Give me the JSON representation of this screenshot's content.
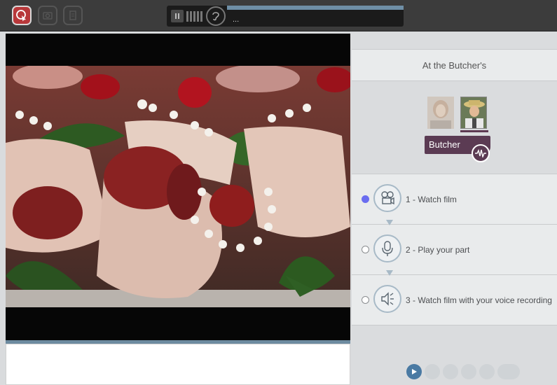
{
  "toolbar": {
    "buttons": [
      {
        "icon": "pointer-icon",
        "state": "active"
      },
      {
        "icon": "camera-icon",
        "state": "disabled"
      },
      {
        "icon": "document-icon",
        "state": "disabled"
      }
    ]
  },
  "player": {
    "status_text": "...",
    "progress": 1.0
  },
  "scene": {
    "title": "At the Butcher's"
  },
  "characters": [
    {
      "icon": "woman-avatar-icon",
      "selected": false
    },
    {
      "icon": "butcher-avatar-icon",
      "selected": true
    }
  ],
  "role": {
    "label": "Butcher"
  },
  "steps": [
    {
      "label": "1 - Watch film",
      "selected": true,
      "icon": "film-camera-icon"
    },
    {
      "label": "2 - Play your part",
      "selected": false,
      "icon": "microphone-icon"
    },
    {
      "label": "3 - Watch film with your voice recording",
      "selected": false,
      "icon": "speaker-icon"
    }
  ],
  "colors": {
    "accent": "#5b3b53",
    "active_tool": "#b8383a",
    "radio_selected": "#6a6df0",
    "progress": "#6d8ba0"
  }
}
